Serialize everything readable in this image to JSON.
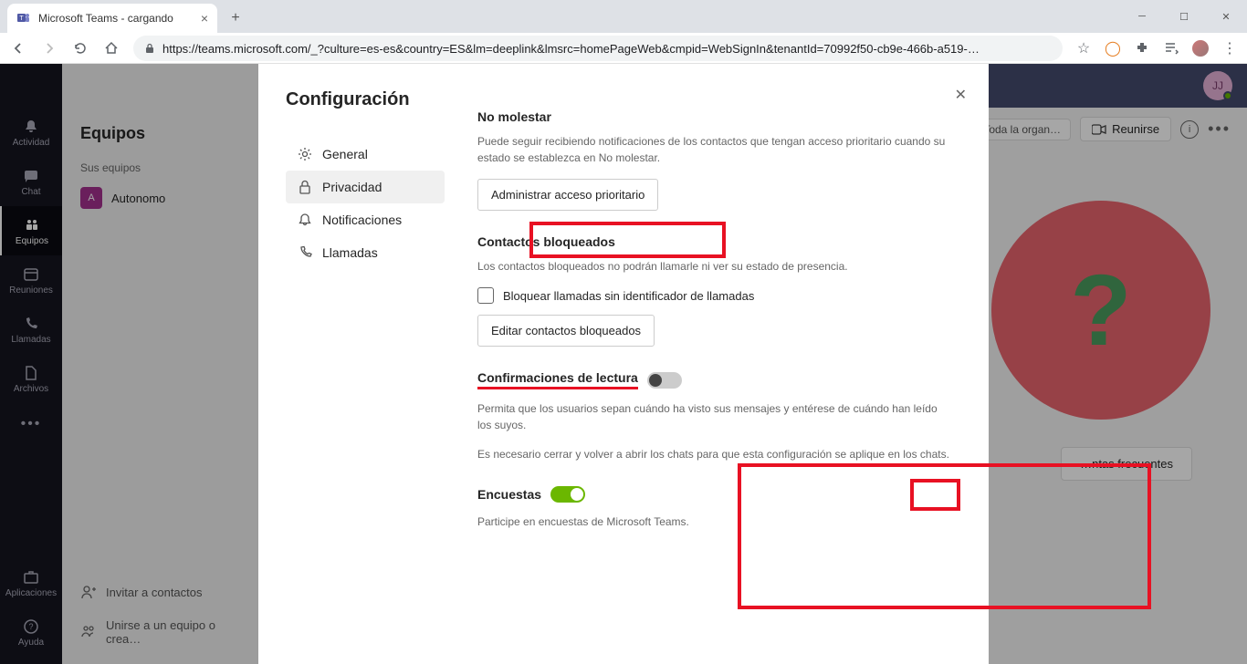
{
  "browser": {
    "tab_title": "Microsoft Teams - cargando",
    "url": "https://teams.microsoft.com/_?culture=es-es&country=ES&lm=deeplink&lmsrc=homePageWeb&cmpid=WebSignIn&tenantId=70992f50-cb9e-466b-a519-…"
  },
  "header": {
    "avatar_initials": "JJ"
  },
  "rail": {
    "items": [
      {
        "label": "Actividad"
      },
      {
        "label": "Chat"
      },
      {
        "label": "Equipos"
      },
      {
        "label": "Reuniones"
      },
      {
        "label": "Llamadas"
      },
      {
        "label": "Archivos"
      }
    ],
    "apps_label": "Aplicaciones",
    "help_label": "Ayuda"
  },
  "channels": {
    "title": "Equipos",
    "subtitle": "Sus equipos",
    "team": {
      "initial": "A",
      "name": "Autonomo"
    },
    "invite": "Invitar a contactos",
    "join": "Unirse a un equipo o crea…"
  },
  "toolbar": {
    "org": "Toda la organ…",
    "meet": "Reunirse",
    "faq": "…ntas frecuentes"
  },
  "modal": {
    "title": "Configuración",
    "nav": {
      "general": "General",
      "privacy": "Privacidad",
      "notifications": "Notificaciones",
      "calls": "Llamadas"
    },
    "dnd": {
      "head": "No molestar",
      "desc": "Puede seguir recibiendo notificaciones de los contactos que tengan acceso prioritario cuando su estado se establezca en No molestar.",
      "btn": "Administrar acceso prioritario"
    },
    "blocked": {
      "head": "Contactos bloqueados",
      "desc": "Los contactos bloqueados no podrán llamarle ni ver su estado de presencia.",
      "check": "Bloquear llamadas sin identificador de llamadas",
      "btn": "Editar contactos bloqueados"
    },
    "read": {
      "head": "Confirmaciones de lectura",
      "desc1": "Permita que los usuarios sepan cuándo ha visto sus mensajes y entérese de cuándo han leído los suyos.",
      "desc2": "Es necesario cerrar y volver a abrir los chats para que esta configuración se aplique en los chats."
    },
    "surveys": {
      "head": "Encuestas",
      "desc": "Participe en encuestas de Microsoft Teams."
    }
  }
}
